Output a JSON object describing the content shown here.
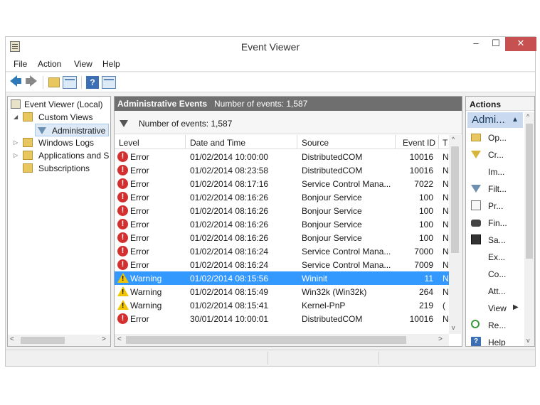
{
  "window": {
    "title": "Event Viewer",
    "minimize": "–",
    "maximize": "☐",
    "close": "✕"
  },
  "menu": [
    "File",
    "Action",
    "View",
    "Help"
  ],
  "toolbar": {
    "back": "🡄",
    "forward": "🡆",
    "help": "?"
  },
  "tree": {
    "root": "Event Viewer (Local)",
    "custom_views": "Custom Views",
    "administrative": "Administrative",
    "windows_logs": "Windows Logs",
    "applications": "Applications and S",
    "subscriptions": "Subscriptions",
    "expanded": "◢",
    "collapsed": "▷"
  },
  "center": {
    "header_title": "Administrative Events",
    "header_count": "Number of events: 1,587",
    "filter_text": "Number of events: 1,587",
    "columns": {
      "level": "Level",
      "date": "Date and Time",
      "source": "Source",
      "event_id": "Event ID",
      "task": "T"
    },
    "sort_indicator": "^",
    "rows": [
      {
        "level": "Error",
        "date": "01/02/2014 10:00:00",
        "source": "DistributedCOM",
        "id": "10016",
        "task": "N"
      },
      {
        "level": "Error",
        "date": "01/02/2014 08:23:58",
        "source": "DistributedCOM",
        "id": "10016",
        "task": "N"
      },
      {
        "level": "Error",
        "date": "01/02/2014 08:17:16",
        "source": "Service Control Mana...",
        "id": "7022",
        "task": "N"
      },
      {
        "level": "Error",
        "date": "01/02/2014 08:16:26",
        "source": "Bonjour Service",
        "id": "100",
        "task": "N"
      },
      {
        "level": "Error",
        "date": "01/02/2014 08:16:26",
        "source": "Bonjour Service",
        "id": "100",
        "task": "N"
      },
      {
        "level": "Error",
        "date": "01/02/2014 08:16:26",
        "source": "Bonjour Service",
        "id": "100",
        "task": "N"
      },
      {
        "level": "Error",
        "date": "01/02/2014 08:16:26",
        "source": "Bonjour Service",
        "id": "100",
        "task": "N"
      },
      {
        "level": "Error",
        "date": "01/02/2014 08:16:24",
        "source": "Service Control Mana...",
        "id": "7000",
        "task": "N"
      },
      {
        "level": "Error",
        "date": "01/02/2014 08:16:24",
        "source": "Service Control Mana...",
        "id": "7009",
        "task": "N"
      },
      {
        "level": "Warning",
        "date": "01/02/2014 08:15:56",
        "source": "Wininit",
        "id": "11",
        "task": "N"
      },
      {
        "level": "Warning",
        "date": "01/02/2014 08:15:49",
        "source": "Win32k (Win32k)",
        "id": "264",
        "task": "N"
      },
      {
        "level": "Warning",
        "date": "01/02/2014 08:15:41",
        "source": "Kernel-PnP",
        "id": "219",
        "task": "("
      },
      {
        "level": "Error",
        "date": "30/01/2014 10:00:01",
        "source": "DistributedCOM",
        "id": "10016",
        "task": "N"
      }
    ],
    "selected_row": 9
  },
  "actions": {
    "header": "Actions",
    "sub": "Admi...",
    "items": [
      {
        "label": "Op...",
        "icon": "folder-open-icon"
      },
      {
        "label": "Cr...",
        "icon": "create-filter-icon"
      },
      {
        "label": "Im...",
        "icon": "none"
      },
      {
        "label": "Filt...",
        "icon": "filter-icon"
      },
      {
        "label": "Pr...",
        "icon": "properties-icon"
      },
      {
        "label": "Fin...",
        "icon": "binoculars-icon"
      },
      {
        "label": "Sa...",
        "icon": "save-icon"
      },
      {
        "label": "Ex...",
        "icon": "none"
      },
      {
        "label": "Co...",
        "icon": "none"
      },
      {
        "label": "Att...",
        "icon": "none"
      },
      {
        "label": "View",
        "icon": "none"
      },
      {
        "label": "Re...",
        "icon": "refresh-icon"
      },
      {
        "label": "Help",
        "icon": "help-icon"
      }
    ]
  },
  "colors": {
    "selection": "#3399ff",
    "header": "#6f6f6f",
    "close": "#c75050",
    "error": "#d32f2f",
    "warning": "#f2c400"
  }
}
